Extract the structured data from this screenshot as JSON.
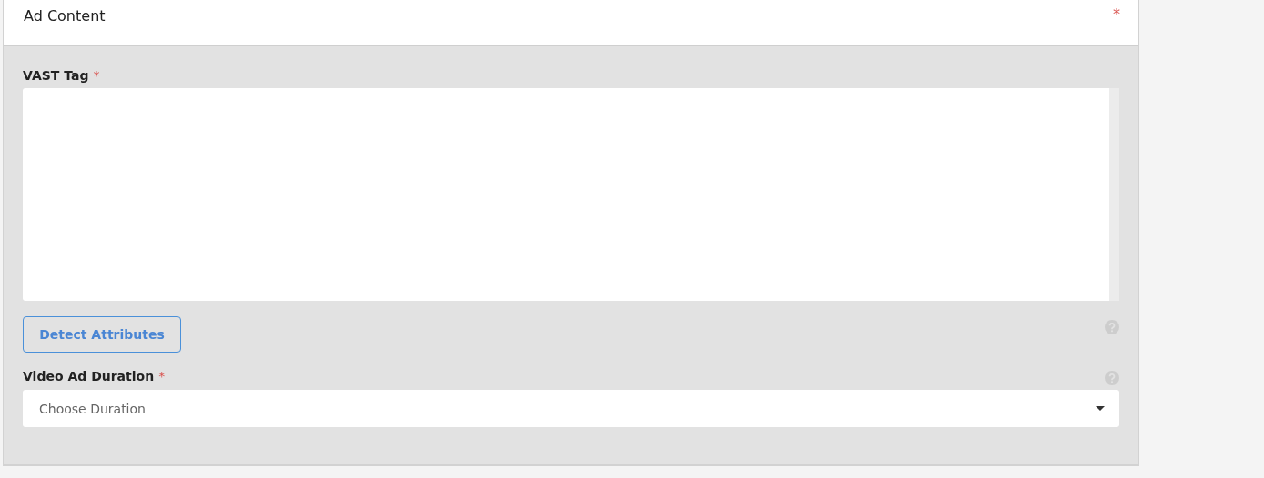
{
  "panel": {
    "title": "Ad Content",
    "required_mark": "*"
  },
  "vast_tag": {
    "label": "VAST Tag",
    "required_mark": "*"
  },
  "detect_button": {
    "label": "Detect Attributes"
  },
  "duration": {
    "label": "Video Ad Duration",
    "required_mark": "*",
    "placeholder": "Choose Duration"
  }
}
